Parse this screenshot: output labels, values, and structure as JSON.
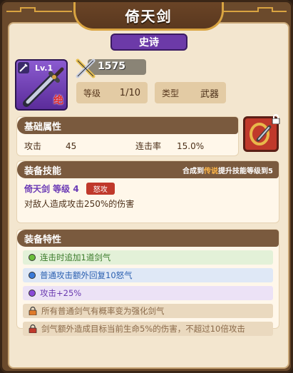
{
  "header": {
    "title": "倚天剑"
  },
  "rarity": {
    "label": "史诗"
  },
  "item": {
    "level_label": "Lv.1",
    "grade_badge": "绝"
  },
  "power": {
    "value": "1575"
  },
  "stats": {
    "level_key": "等级",
    "level_value": "1/10",
    "type_key": "类型",
    "type_value": "武器"
  },
  "base_attributes": {
    "title": "基础属性",
    "attack_key": "攻击",
    "attack_value": "45",
    "crit_key": "连击率",
    "crit_value": "15.0%"
  },
  "skill": {
    "title": "装备技能",
    "hint_prefix": "合成到",
    "hint_highlight": "传说",
    "hint_suffix": "提升技能等级到5",
    "name": "倚天剑 等级 4",
    "tag": "怒攻",
    "description": "对敌人造成攻击250%的伤害"
  },
  "traits": {
    "title": "装备特性",
    "items": [
      {
        "text": "连击时追加1道剑气",
        "style": "green",
        "dot_color": "#6abf3a"
      },
      {
        "text": "普通攻击额外回复10怒气",
        "style": "blue",
        "dot_color": "#3a7ad8"
      },
      {
        "text": "攻击+25%",
        "style": "purple",
        "dot_color": "#8a4ad8"
      },
      {
        "text": "所有普通剑气有概率变为强化剑气",
        "style": "locked-orange"
      },
      {
        "text": "剑气额外造成目标当前生命5%的伤害，不超过10倍攻击",
        "style": "locked-red"
      }
    ]
  },
  "colors": {
    "frame": "#6b4a2c",
    "panel": "#f3e6cf",
    "rarity_epic": "#6c3aa8",
    "accent_gold": "#d9a441"
  }
}
